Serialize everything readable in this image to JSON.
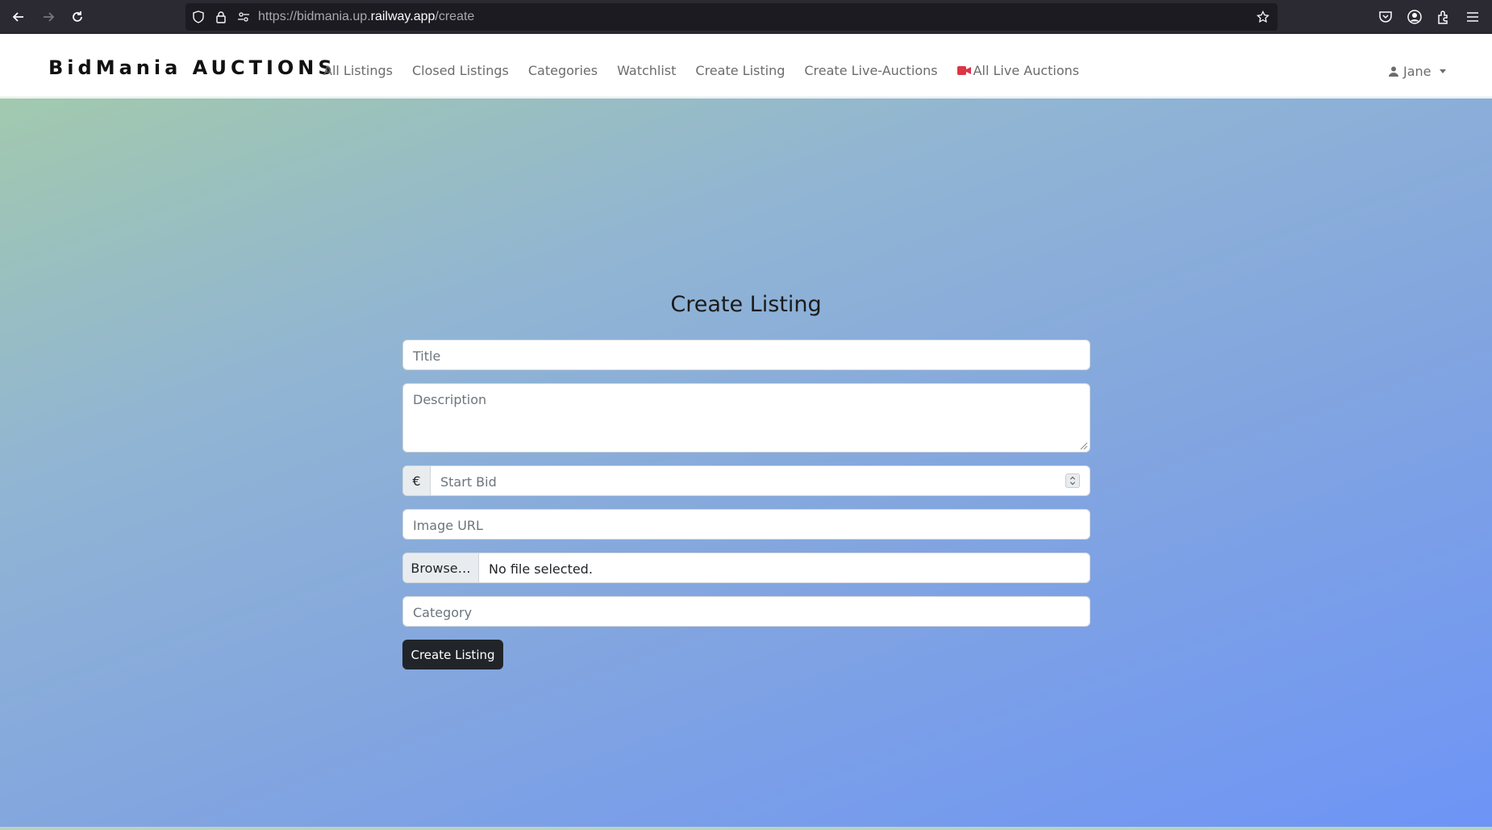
{
  "browser": {
    "url_prefix": "https://bidmania.up.",
    "url_host": "railway.app",
    "url_path": "/create"
  },
  "navbar": {
    "brand": "BidMania AUCTIONS",
    "links": [
      "All Listings",
      "Closed Listings",
      "Categories",
      "Watchlist",
      "Create Listing",
      "Create Live-Auctions"
    ],
    "live_link": "All Live Auctions",
    "user": "Jane"
  },
  "form": {
    "heading": "Create Listing",
    "title_placeholder": "Title",
    "description_placeholder": "Description",
    "currency_symbol": "€",
    "start_bid_placeholder": "Start Bid",
    "image_url_placeholder": "Image URL",
    "browse_label": "Browse…",
    "file_status": "No file selected.",
    "category_placeholder": "Category",
    "submit_label": "Create Listing"
  },
  "colors": {
    "camera_icon": "#dc3545",
    "button_bg": "#212529",
    "gradient_start": "#a2c9ae",
    "gradient_end": "#6d94f6"
  }
}
